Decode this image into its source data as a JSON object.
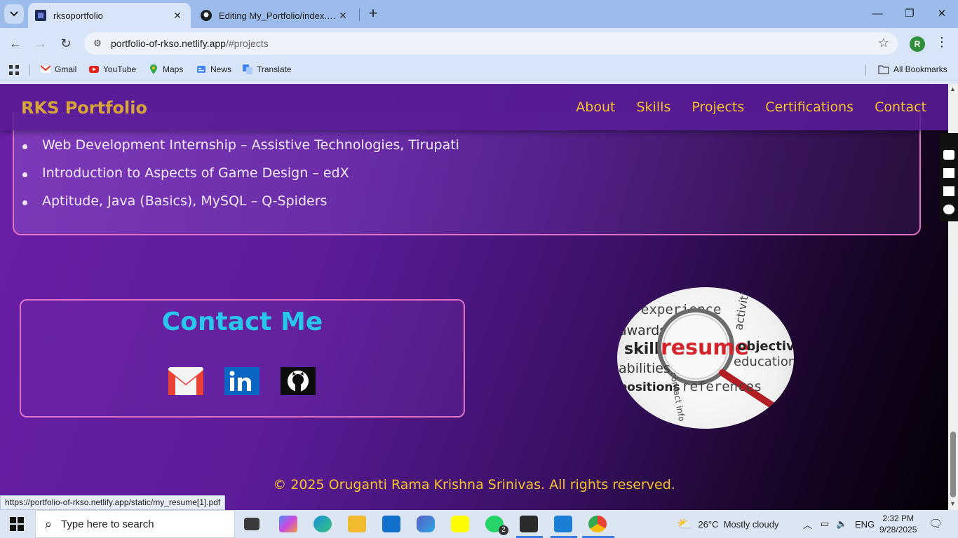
{
  "browser": {
    "tabs": [
      {
        "title": "rksoportfolio",
        "active": true
      },
      {
        "title": "Editing My_Portfolio/index.html",
        "active": false
      }
    ],
    "address": {
      "host": "portfolio-of-rkso.netlify.app",
      "path": "/#projects"
    },
    "profile_initial": "R",
    "bookmarks": [
      {
        "label": "Gmail",
        "icon": "gmail-icon"
      },
      {
        "label": "YouTube",
        "icon": "youtube-icon"
      },
      {
        "label": "Maps",
        "icon": "maps-icon"
      },
      {
        "label": "News",
        "icon": "news-icon"
      },
      {
        "label": "Translate",
        "icon": "translate-icon"
      }
    ],
    "all_bookmarks_label": "All Bookmarks",
    "status_url": "https://portfolio-of-rkso.netlify.app/static/my_resume[1].pdf"
  },
  "site": {
    "brand": "RKS Portfolio",
    "nav": [
      "About",
      "Skills",
      "Projects",
      "Certifications",
      "Contact"
    ],
    "certifications": [
      "Web Development Internship – Assistive Technologies, Tirupati",
      "Introduction to Aspects of Game Design – edX",
      "Aptitude, Java (Basics), MySQL – Q-Spiders"
    ],
    "contact_title": "Contact Me",
    "resume_words": [
      "experience",
      "activities",
      "awards",
      "skills",
      "resume",
      "objective",
      "abilities",
      "education",
      "positions",
      "contact info",
      "references"
    ],
    "copyright": "© 2025 Oruganti Rama Krishna Srinivas. All rights reserved."
  },
  "taskbar": {
    "search_placeholder": "Type here to search",
    "weather": {
      "temp": "26°C",
      "condition": "Mostly cloudy"
    },
    "language": "ENG",
    "time": "2:32 PM",
    "date": "9/28/2025",
    "whatsapp_badge": "2"
  },
  "colors": {
    "brand_gold": "#d8a53a",
    "nav_gold": "#f5c12c",
    "card_border_pink": "#e472c4",
    "contact_cyan": "#27c6ea"
  }
}
